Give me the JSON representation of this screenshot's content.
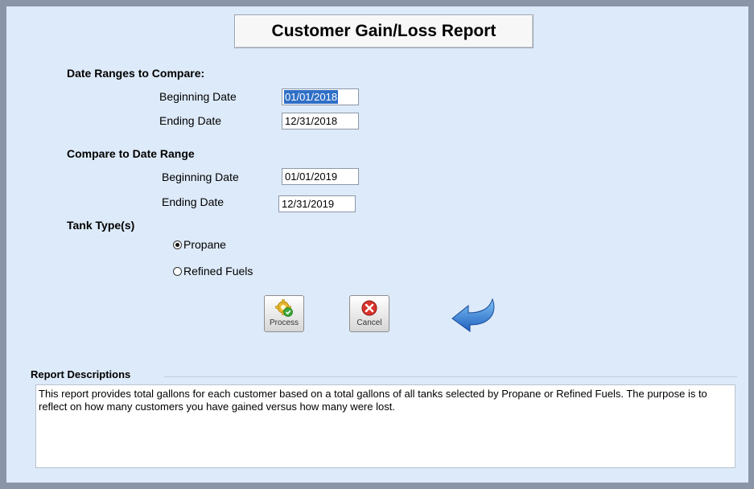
{
  "title": "Customer Gain/Loss Report",
  "date_ranges": {
    "label": "Date Ranges to Compare:",
    "beginning_label": "Beginning Date",
    "beginning_value": "01/01/2018",
    "ending_label": "Ending Date",
    "ending_value": "12/31/2018"
  },
  "compare_range": {
    "label": "Compare to Date Range",
    "beginning_label": "Beginning Date",
    "beginning_value": "01/01/2019",
    "ending_label": "Ending Date",
    "ending_value": "12/31/2019"
  },
  "tank_types": {
    "label": "Tank Type(s)",
    "options": [
      {
        "label": "Propane",
        "selected": true
      },
      {
        "label": "Refined Fuels",
        "selected": false
      }
    ]
  },
  "buttons": {
    "process_label": "Process",
    "cancel_label": "Cancel",
    "back_icon": "back-arrow-icon"
  },
  "description": {
    "label": "Report Descriptions",
    "text": "This report provides total gallons for each customer based on a total gallons of all tanks selected by Propane or Refined Fuels. The purpose is to reflect on how many customers you have gained versus how many were lost."
  },
  "colors": {
    "panel_bg": "#ddeaf9",
    "frame": "#8a96a8",
    "selection": "#2f6fc6",
    "arrow": "#2e7fd6"
  }
}
